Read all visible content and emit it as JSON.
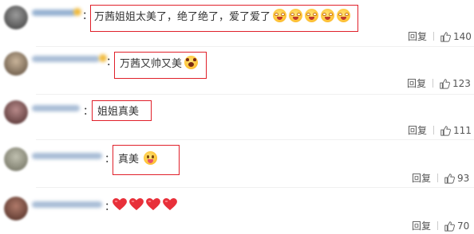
{
  "comments": [
    {
      "text": "万茜姐姐太美了，绝了绝了，爱了爱了",
      "emojis": [
        "heart-eyes-emoji",
        "heart-eyes-emoji",
        "heart-eyes-emoji",
        "heart-eyes-emoji",
        "heart-eyes-emoji"
      ],
      "reply_label": "回复",
      "likes": "140"
    },
    {
      "text": "万茜又帅又美",
      "emojis": [
        "shocked-emoji"
      ],
      "reply_label": "回复",
      "likes": "123"
    },
    {
      "text": "姐姐真美",
      "emojis": [],
      "reply_label": "回复",
      "likes": "111"
    },
    {
      "text": "真美",
      "emojis": [
        "tongue-out-emoji"
      ],
      "reply_label": "回复",
      "likes": "93"
    },
    {
      "text": "",
      "emojis": [
        "red-heart-emoji",
        "red-heart-emoji",
        "red-heart-emoji",
        "red-heart-emoji"
      ],
      "reply_label": "回复",
      "likes": "70"
    }
  ],
  "colon": "：",
  "colors": {
    "highlight_box": "#e0202a",
    "text": "#333333",
    "muted": "#555555",
    "heart": "#e8303a"
  }
}
